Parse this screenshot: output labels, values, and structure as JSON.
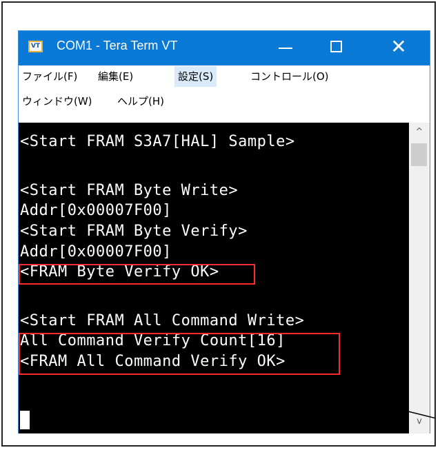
{
  "window": {
    "title": "COM1 - Tera Term VT",
    "icon_text": "VT",
    "controls": {
      "minimize": "minimize-icon",
      "maximize": "maximize-icon",
      "close": "✕"
    }
  },
  "menu": {
    "file": "ファイル(F)",
    "edit": "編集(E)",
    "setup": "設定(S)",
    "control": "コントロール(O)",
    "window": "ウィンドウ(W)",
    "help": "ヘルプ(H)"
  },
  "terminal": {
    "lines": [
      "<Start FRAM S3A7[HAL] Sample>",
      "<Start FRAM Byte Write>",
      "Addr[0x00007F00]",
      "<Start FRAM Byte Verify>",
      "Addr[0x00007F00]",
      "<FRAM Byte Verify OK>",
      "<Start FRAM All Command Write>",
      "All Command Verify Count[16]",
      "<FRAM All Command Verify OK>"
    ]
  },
  "scrollbar": {
    "up": "^",
    "down": "v"
  },
  "colors": {
    "titlebar": "#0b7ad6",
    "terminal_bg": "#000000",
    "terminal_fg": "#ffffff",
    "highlight": "#ff2a2a",
    "menu_active": "#d9ebfa"
  }
}
